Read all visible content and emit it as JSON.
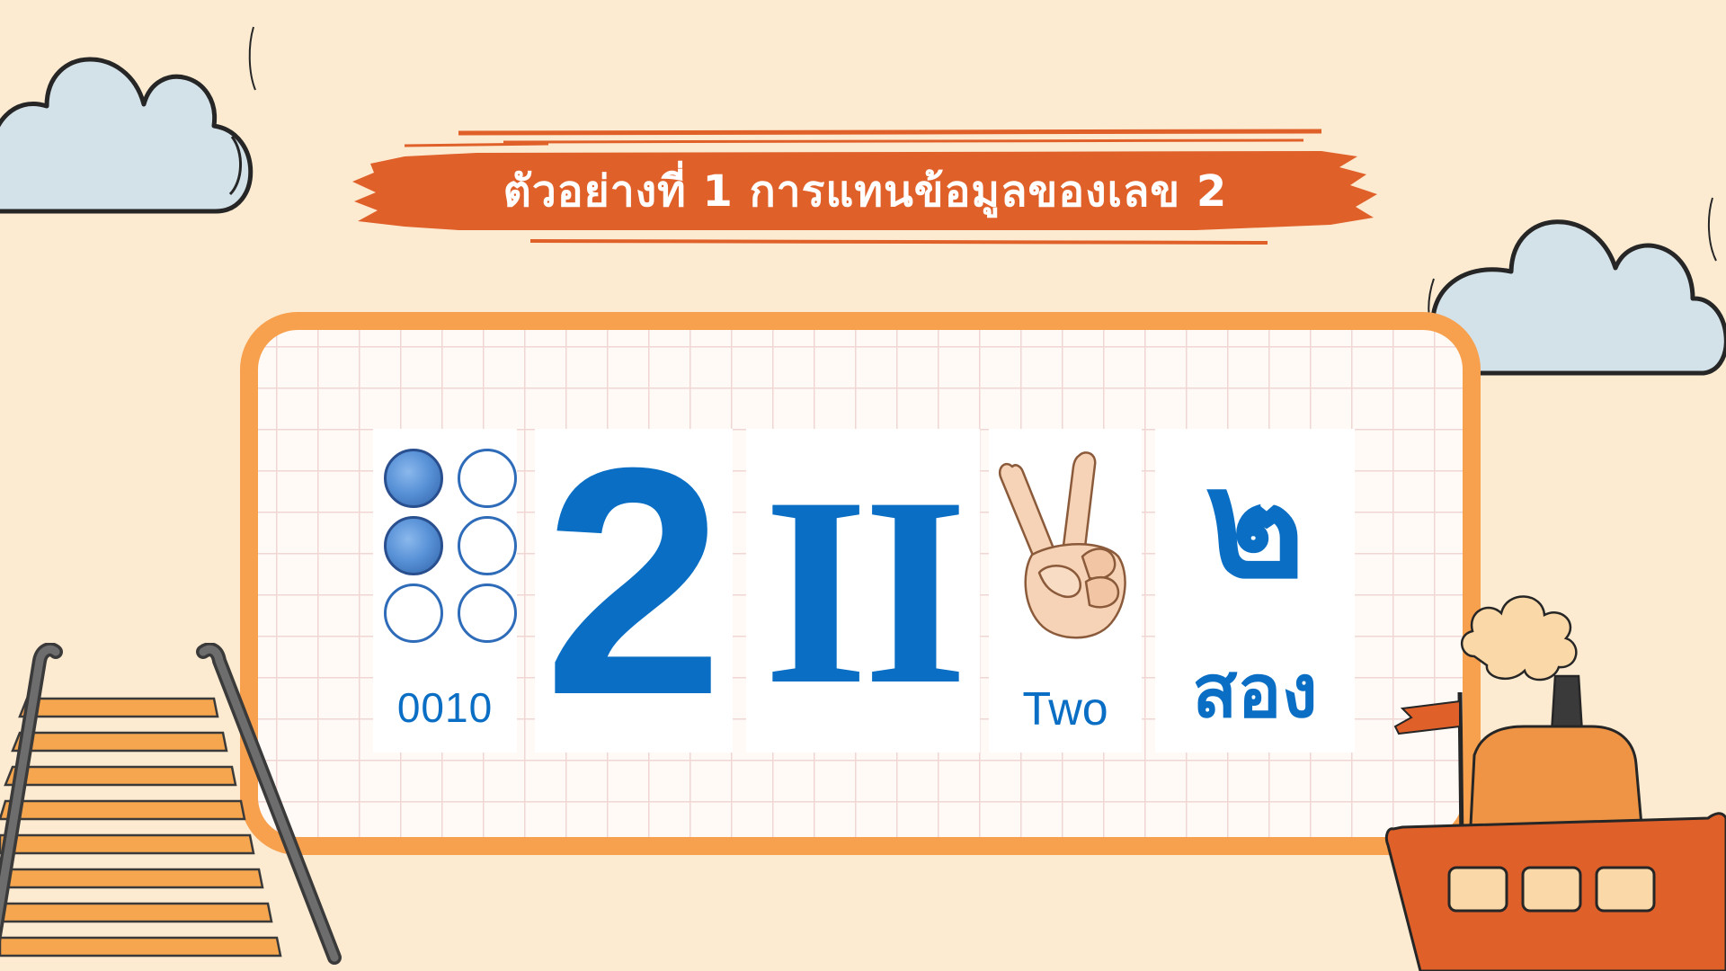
{
  "title": "ตัวอย่างที่ 1 การแทนข้อมูลของเลข 2",
  "examples": {
    "braille": {
      "icon": "braille-dots-icon",
      "dots_filled": [
        true,
        false,
        true,
        false,
        false,
        false
      ],
      "code": "0010"
    },
    "arabic": {
      "numeral": "2"
    },
    "roman": {
      "numeral": "II"
    },
    "hand": {
      "icon": "victory-hand-icon",
      "word": "Two"
    },
    "thai": {
      "numeral": "๒",
      "word": "สอง"
    }
  },
  "decorations": [
    "cloud-icon",
    "cloud-icon",
    "cloud-icon",
    "ladder-icon",
    "steamboat-icon"
  ],
  "colors": {
    "background": "#fdebd1",
    "banner": "#e0602a",
    "board_border": "#f7a04e",
    "numeral_blue": "#0a6ec4",
    "cloud": "#d3e1e8"
  }
}
